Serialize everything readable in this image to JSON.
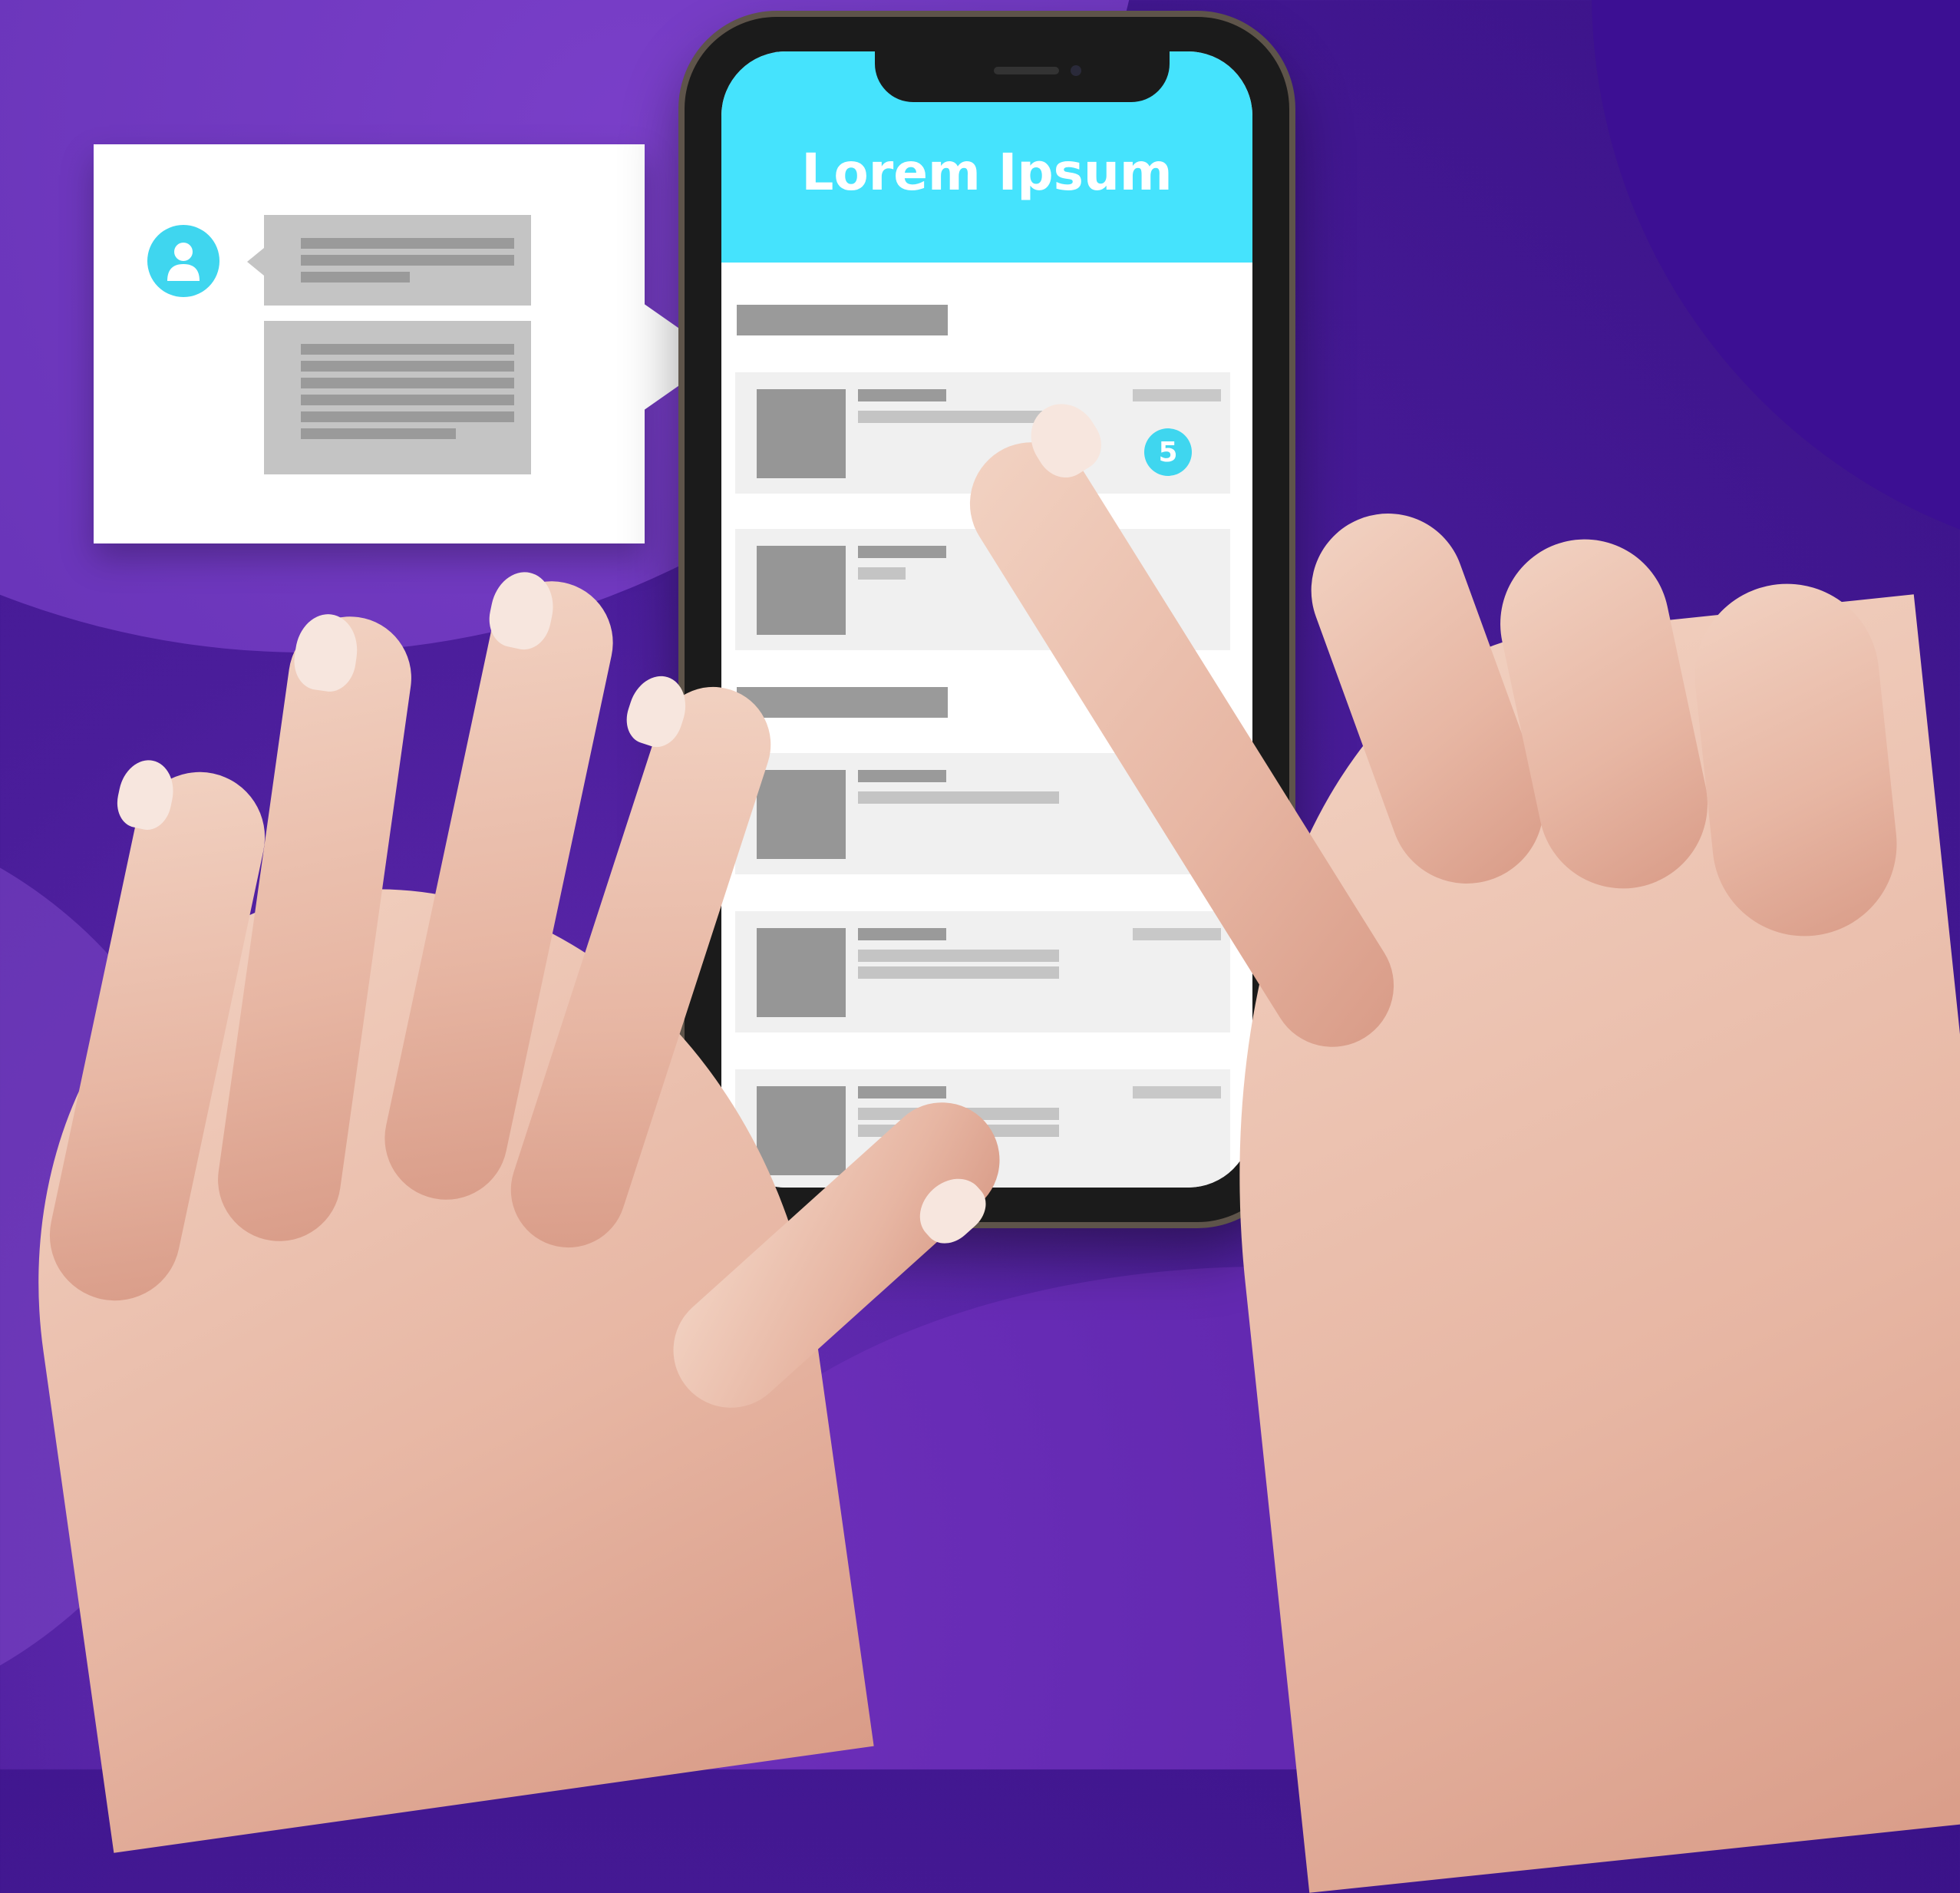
{
  "app": {
    "title": "Lorem Ipsum",
    "badge_count": "5"
  },
  "colors": {
    "background": "#4a1d9a",
    "accent": "#45e3fd",
    "placeholder_dark": "#969696",
    "placeholder_light": "#c4c4c4",
    "card_background": "#f0f0f0"
  },
  "icons": {
    "avatar": "user-icon"
  },
  "sections": [
    {
      "cards": 2
    },
    {
      "cards": 3
    }
  ]
}
